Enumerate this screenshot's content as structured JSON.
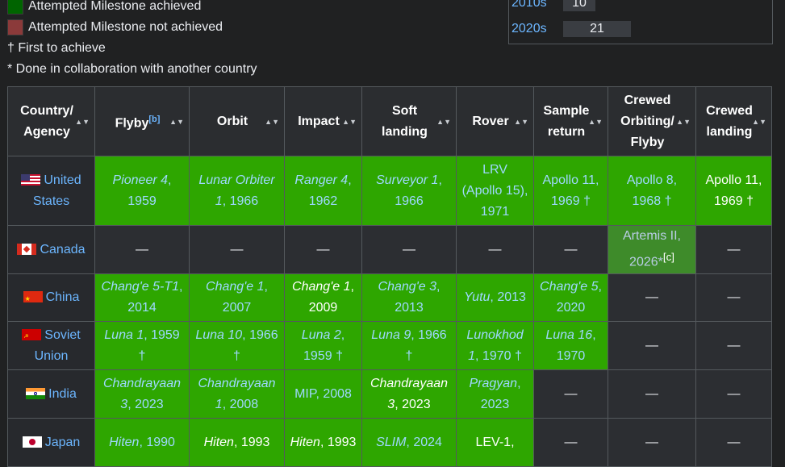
{
  "legend": {
    "achieved": "Attempted Milestone achieved",
    "not_achieved": "Attempted Milestone not achieved",
    "first": "† First to achieve",
    "collab": "* Done in collaboration with another country"
  },
  "decades": [
    {
      "label": "2010s",
      "count": "10",
      "fraction": 0.476
    },
    {
      "label": "2020s",
      "count": "21",
      "fraction": 1.0
    }
  ],
  "headers": {
    "country": [
      "Country/",
      "Agency"
    ],
    "flyby": "Flyby",
    "flyby_note": "[b]",
    "orbit": "Orbit",
    "impact": "Impact",
    "soft_landing": [
      "Soft",
      "landing"
    ],
    "rover": "Rover",
    "sample_return": [
      "Sample",
      "return"
    ],
    "crewed_orbiting": [
      "Crewed",
      "Orbiting/",
      "Flyby"
    ],
    "crewed_landing": [
      "Crewed",
      "landing"
    ],
    "sort_glyph": "▲▼"
  },
  "rows": {
    "us": {
      "country": "United States",
      "flyby_name": "Pioneer 4",
      "flyby_year": ", 1959",
      "orbit_name": "Lunar Orbiter 1",
      "orbit_year": ", 1966",
      "impact_name": "Ranger 4",
      "impact_year": ", 1962",
      "soft_name": "Surveyor 1",
      "soft_year": ", 1966",
      "rover": "LRV (Apollo 15), 1971",
      "sample": "Apollo 11, 1969 †",
      "crewed_orbit": "Apollo 8, 1968 †",
      "crewed_landing": "Apollo 11, 1969 †"
    },
    "ca": {
      "country": "Canada",
      "dash": "—",
      "crewed_orbit": "Artemis II, 2026*",
      "crewed_orbit_note": "[c]"
    },
    "cn": {
      "country": "China",
      "flyby_name": "Chang'e 5-T1",
      "flyby_year": ", 2014",
      "orbit_name": "Chang'e 1",
      "orbit_year": ", 2007",
      "impact_name": "Chang'e 1",
      "impact_year": ", 2009",
      "soft_name": "Chang'e 3",
      "soft_year": ", 2013",
      "rover_name": "Yutu",
      "rover_year": ", 2013",
      "sample_name": "Chang'e 5",
      "sample_year": ", 2020",
      "dash": "—"
    },
    "su": {
      "country": "Soviet Union",
      "flyby_name": "Luna 1",
      "flyby_year": ", 1959 †",
      "orbit_name": "Luna 10",
      "orbit_year": ", 1966 †",
      "impact_name": "Luna 2",
      "impact_year": ", 1959 †",
      "soft_name": "Luna 9",
      "soft_year": ", 1966 †",
      "rover_name": "Lunokhod 1",
      "rover_year": ", 1970 †",
      "sample_name": "Luna 16",
      "sample_year": ", 1970",
      "dash": "—"
    },
    "in": {
      "country": "India",
      "flyby_name": "Chandrayaan 3",
      "flyby_year": ", 2023",
      "orbit_name": "Chandrayaan 1",
      "orbit_year": ", 2008",
      "impact": "MIP, 2008",
      "soft_name": "Chandrayaan 3",
      "soft_year": ", 2023",
      "rover_name": "Pragyan",
      "rover_year": ", 2023",
      "dash": "—"
    },
    "jp": {
      "country": "Japan",
      "flyby_name": "Hiten",
      "flyby_year": ", 1990",
      "orbit_name": "Hiten",
      "orbit_year": ", 1993",
      "impact_name": "Hiten",
      "impact_year": ", 1993",
      "soft_name": "SLIM",
      "soft_year": ", 2024",
      "rover": "LEV-1,",
      "dash": "—"
    }
  },
  "colors": {
    "achieved": "#2ea600",
    "legend_achieved": "#006400",
    "legend_not_achieved": "#8b3a3a",
    "link": "#6cb6ff"
  }
}
